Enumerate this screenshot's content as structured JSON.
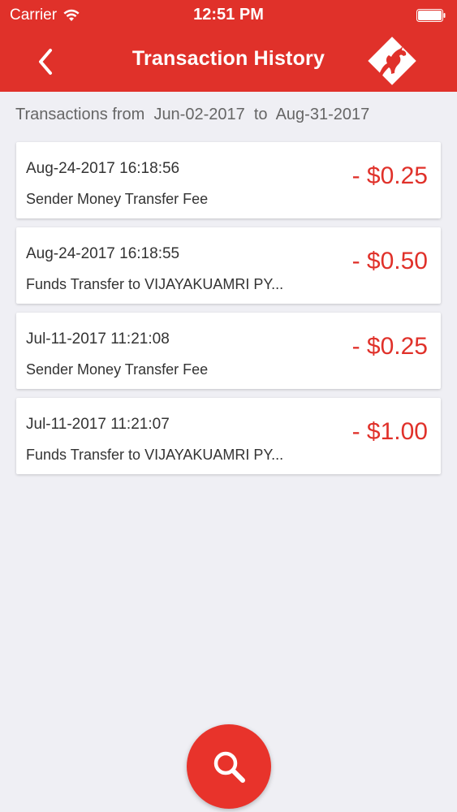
{
  "status_bar": {
    "carrier": "Carrier",
    "time": "12:51 PM",
    "icons": [
      "wifi-icon",
      "battery-icon"
    ]
  },
  "header": {
    "title": "Transaction History",
    "back_icon": "chevron-left-icon",
    "logo_icon": "horse-logo-icon",
    "background_color": "#e0312a"
  },
  "date_range": {
    "prefix": "Transactions from",
    "start": "Jun-02-2017",
    "separator": "to",
    "end": "Aug-31-2017"
  },
  "transactions": [
    {
      "datetime": "Aug-24-2017 16:18:56",
      "description": "Sender Money Transfer Fee",
      "amount": "- $0.25"
    },
    {
      "datetime": "Aug-24-2017 16:18:55",
      "description": "Funds Transfer to VIJAYAKUAMRI PY...",
      "amount": "- $0.50"
    },
    {
      "datetime": "Jul-11-2017 11:21:08",
      "description": "Sender Money Transfer Fee",
      "amount": "- $0.25"
    },
    {
      "datetime": "Jul-11-2017 11:21:07",
      "description": "Funds Transfer to VIJAYAKUAMRI PY...",
      "amount": "- $1.00"
    }
  ],
  "search_button": {
    "icon": "search-icon"
  },
  "colors": {
    "accent": "#e0312a",
    "amount": "#e0312a",
    "background": "#efeff4"
  }
}
